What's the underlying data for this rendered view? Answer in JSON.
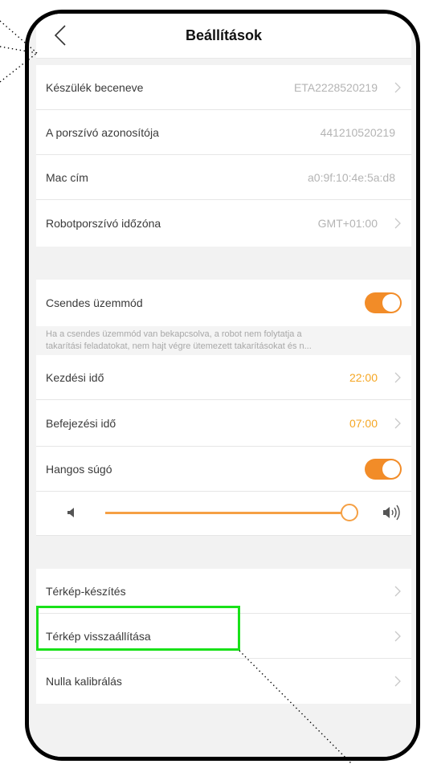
{
  "header": {
    "title": "Beállítások",
    "back_icon": "chevron-left-icon"
  },
  "device": {
    "nickname_label": "Készülék beceneve",
    "nickname_value": "ETA2228520219",
    "id_label": "A porszívó azonosítója",
    "id_value": "441210520219",
    "mac_label": "Mac cím",
    "mac_value": "a0:9f:10:4e:5a:d8",
    "timezone_label": "Robotporszívó időzóna",
    "timezone_value": "GMT+01:00"
  },
  "quiet_mode": {
    "label": "Csendes üzemmód",
    "enabled": true,
    "description_line1": "Ha a csendes üzemmód van bekapcsolva, a robot nem folytatja a",
    "description_line2": "takarítási feladatokat, nem hajt végre ütemezett takarításokat és n...",
    "start_label": "Kezdési idő",
    "start_value": "22:00",
    "end_label": "Befejezési idő",
    "end_value": "07:00"
  },
  "voice": {
    "label": "Hangos súgó",
    "enabled": true,
    "volume_level": 1.0,
    "low_icon": "speaker-low-icon",
    "high_icon": "speaker-high-icon"
  },
  "map": {
    "build_label": "Térkép-készítés",
    "restore_label": "Térkép visszaállítása",
    "calibrate_label": "Nulla kalibrálás"
  },
  "colors": {
    "accent": "#f5a623",
    "toggle": "#f28c28",
    "highlight": "#19e119"
  }
}
